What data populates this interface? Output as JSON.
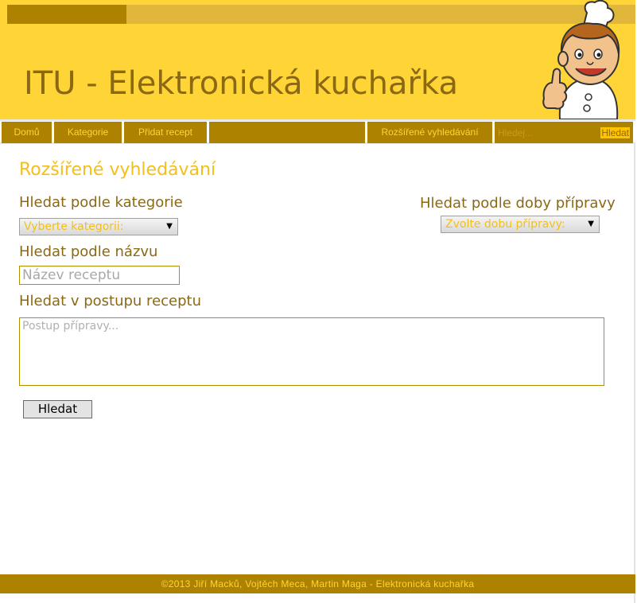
{
  "header": {
    "title": "ITU - Elektronická kuchařka",
    "mascot": "chef-thumbs-up"
  },
  "nav": {
    "items": [
      {
        "label": "Domů"
      },
      {
        "label": "Kategorie"
      },
      {
        "label": "Přidat recept"
      },
      {
        "label": ""
      },
      {
        "label": "Rozšířené vyhledávání"
      }
    ],
    "search": {
      "placeholder": "Hledej...",
      "button": "Hledat"
    }
  },
  "main": {
    "heading": "Rozšířené vyhledávání",
    "category": {
      "label": "Hledat podle kategorie",
      "selected": "Vyberte kategorii:"
    },
    "duration": {
      "label": "Hledat podle doby přípravy",
      "selected": "Zvolte dobu přípravy:"
    },
    "name": {
      "label": "Hledat podle názvu",
      "placeholder": "Název receptu"
    },
    "procedure": {
      "label": "Hledat v postupu receptu",
      "placeholder": "Postup přípravy..."
    },
    "submit": "Hledat"
  },
  "footer": {
    "text": "©2013 Jiří Macků, Vojtěch Meca, Martin Maga - Elektronická kuchařka"
  },
  "colors": {
    "header_bg": "#ffd436",
    "accent_dark": "#ad8200",
    "heading_yellow": "#f4bf1a",
    "label_brown": "#8b6914"
  }
}
